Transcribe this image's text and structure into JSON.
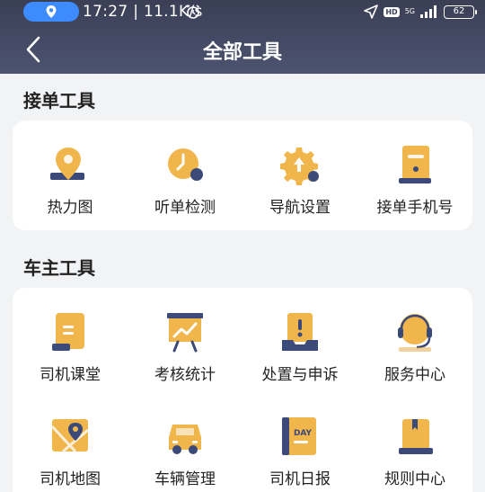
{
  "status_bar": {
    "time": "17:27",
    "speed": "11.1K/s",
    "hd": "HD",
    "network": "5G",
    "battery": "62"
  },
  "header": {
    "title": "全部工具"
  },
  "sections": [
    {
      "title": "接单工具",
      "tools": [
        {
          "label": "热力图",
          "icon": "heatmap-pin-icon"
        },
        {
          "label": "听单检测",
          "icon": "clock-check-icon"
        },
        {
          "label": "导航设置",
          "icon": "gear-upload-icon"
        },
        {
          "label": "接单手机号",
          "icon": "phone-card-icon"
        }
      ]
    },
    {
      "title": "车主工具",
      "tools": [
        {
          "label": "司机课堂",
          "icon": "classroom-doc-icon"
        },
        {
          "label": "考核统计",
          "icon": "chart-board-icon"
        },
        {
          "label": "处置与申诉",
          "icon": "appeal-tray-icon"
        },
        {
          "label": "服务中心",
          "icon": "headset-icon"
        },
        {
          "label": "司机地图",
          "icon": "map-pin-icon"
        },
        {
          "label": "车辆管理",
          "icon": "car-icon"
        },
        {
          "label": "司机日报",
          "icon": "daily-report-icon"
        },
        {
          "label": "规则中心",
          "icon": "rulebook-icon"
        }
      ]
    }
  ],
  "colors": {
    "accent": "#f0b64c",
    "accent_dark": "#e8a33a",
    "navy": "#3b4a78",
    "header_bg": "#3a3f55",
    "location_pill": "#3d8bfd"
  }
}
